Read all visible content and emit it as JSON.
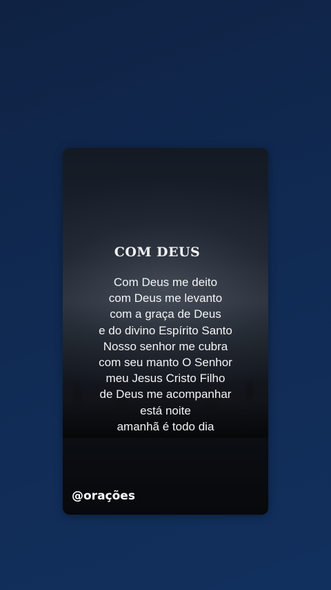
{
  "card": {
    "title": "COM  DEUS",
    "lines": [
      "Com Deus me deito",
      "com Deus me levanto",
      "com a graça de Deus",
      "e do divino Espírito Santo",
      "Nosso senhor me cubra",
      "com seu manto O Senhor",
      "meu Jesus Cristo Filho",
      "de Deus me acompanhar",
      "está noite",
      "amanhã é todo dia"
    ],
    "handle": "@orações"
  },
  "colors": {
    "background": "#102a52",
    "text": "#f4f4f4"
  }
}
